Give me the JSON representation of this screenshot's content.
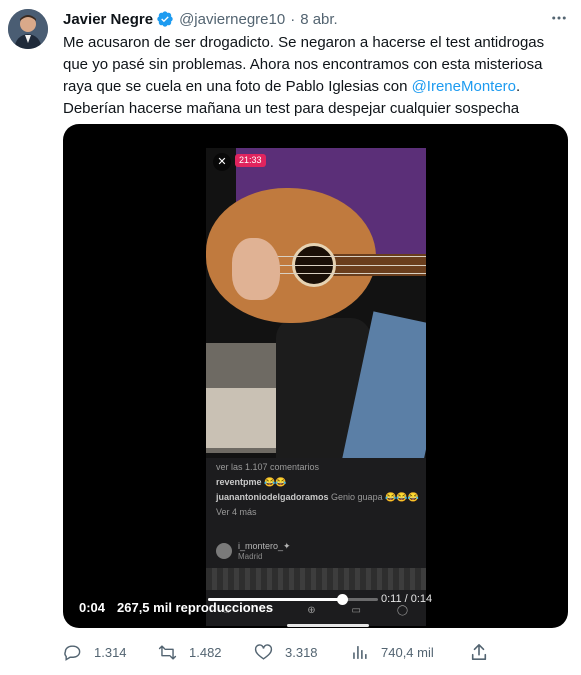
{
  "author": {
    "name": "Javier Negre",
    "handle": "@javiernegre10",
    "separator": "·",
    "date": "8 abr.",
    "verified_color": "#1d9bf0"
  },
  "tweet": {
    "text_before_mention": "Me acusaron de ser drogadicto. Se negaron a hacerse el test antidrogas que yo pasé sin problemas. Ahora nos encontramos con esta misteriosa raya que se cuela en una foto de Pablo Iglesias con ",
    "mention": "@IreneMontero",
    "text_after_mention": ". Deberían hacerse mañana un test para despejar cualquier sospecha"
  },
  "video": {
    "elapsed": "0:04",
    "views": "267,5 mil reproducciones",
    "timer": "0:11 / 0:14",
    "progress": 0.79,
    "live_badge": "21:33",
    "live_close": "✕",
    "comments": [
      {
        "user": "",
        "text": "ver las 1.107 comentarios"
      },
      {
        "user": "reventpme",
        "text": "😂😂"
      },
      {
        "user": "juanantoniodelgadoramos",
        "text": "Genio guapa 😂😂😂"
      },
      {
        "user": "",
        "text": "Ver 4 más"
      }
    ],
    "sender_name": "i_montero_✦",
    "sender_sub": "Madrid",
    "phone_nav_icons": [
      "⌂",
      "⌕",
      "⊕",
      "▭",
      "◯"
    ]
  },
  "actions": {
    "reply_count": "1.314",
    "retweet_count": "1.482",
    "like_count": "3.318",
    "views_count": "740,4 mil"
  },
  "colors": {
    "accent": "#1d9bf0",
    "muted": "#536471",
    "text": "#0f1419",
    "live": "#e0245e"
  },
  "icons": [
    "more-icon",
    "verified-icon",
    "reply-icon",
    "retweet-icon",
    "like-icon",
    "views-icon",
    "share-icon"
  ]
}
